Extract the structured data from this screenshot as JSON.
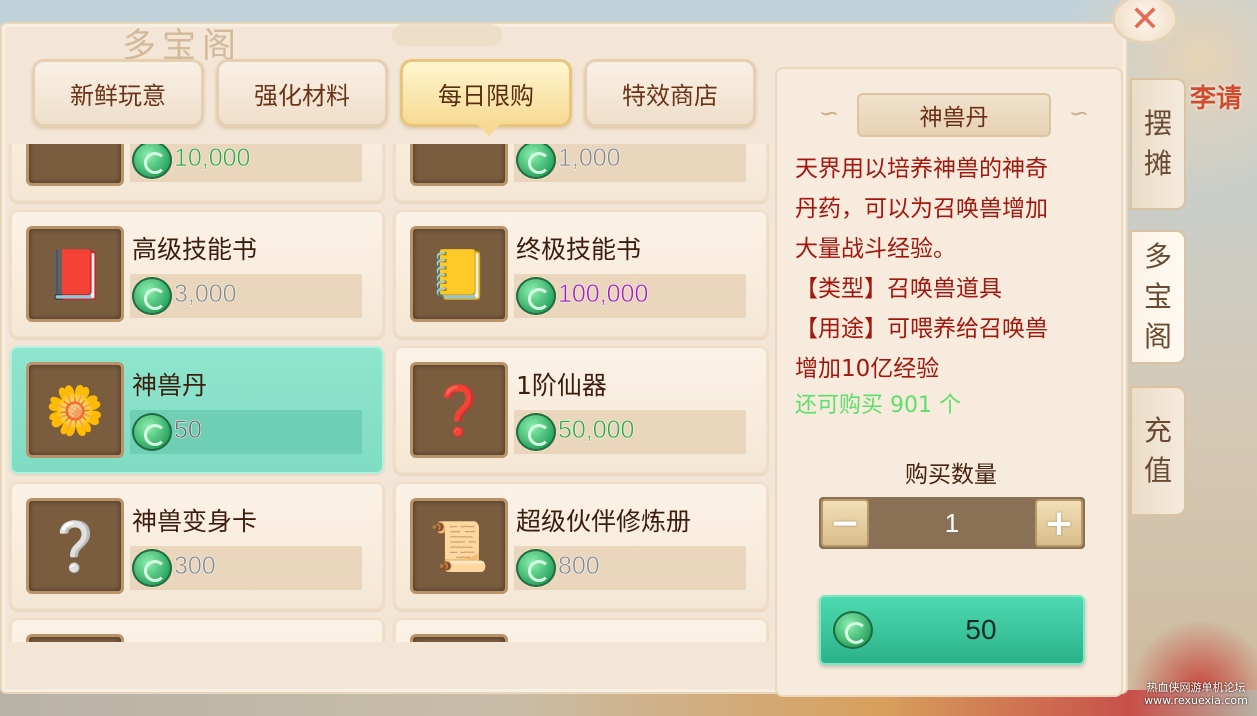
{
  "panel": {
    "title": "多宝阁"
  },
  "tabs": [
    {
      "label": "新鲜玩意"
    },
    {
      "label": "强化材料"
    },
    {
      "label": "每日限购",
      "active": true
    },
    {
      "label": "特效商店"
    }
  ],
  "items": [
    {
      "name": "",
      "price": "10,000",
      "price_color": "#34a845",
      "icon": "treasure-chest-icon",
      "glyph": ""
    },
    {
      "name": "",
      "price": "1,000",
      "price_color": "#8a8a8a",
      "icon": "blue-book-icon",
      "glyph": ""
    },
    {
      "name": "高级技能书",
      "price": "3,000",
      "price_color": "#8a8a8a",
      "icon": "red-skill-book-icon",
      "glyph": "📕"
    },
    {
      "name": "终极技能书",
      "price": "100,000",
      "price_color": "#a622b5",
      "icon": "gold-skill-book-icon",
      "glyph": "📒"
    },
    {
      "name": "神兽丹",
      "price": "50",
      "price_color": "#6b6b6b",
      "icon": "divine-pill-icon",
      "glyph": "🌼",
      "selected": true
    },
    {
      "name": "1阶仙器",
      "price": "50,000",
      "price_color": "#34a845",
      "icon": "mystery-artifact-icon",
      "glyph": "❓"
    },
    {
      "name": "神兽变身卡",
      "price": "300",
      "price_color": "#8a8a8a",
      "icon": "transform-card-icon",
      "glyph": "❔"
    },
    {
      "name": "超级伙伴修炼册",
      "price": "800",
      "price_color": "#8a8a8a",
      "icon": "training-manual-icon",
      "glyph": "📜"
    },
    {
      "name": "",
      "price": "",
      "price_color": "#8a8a8a",
      "icon": "item-icon",
      "glyph": ""
    },
    {
      "name": "",
      "price": "",
      "price_color": "#8a8a8a",
      "icon": "item-icon",
      "glyph": ""
    }
  ],
  "detail": {
    "title": "神兽丹",
    "desc_lines": [
      "天界用以培养神兽的神奇",
      "丹药，可以为召唤兽增加",
      "大量战斗经验。",
      "【类型】召唤兽道具",
      "【用途】可喂养给召唤兽",
      "增加10亿经验"
    ],
    "remaining": "还可购买 901 个",
    "qty_label": "购买数量",
    "qty_minus": "−",
    "qty_plus": "+",
    "qty_value": "1",
    "buy_price": "50"
  },
  "side_tabs": [
    {
      "chars": [
        "摆",
        "摊"
      ]
    },
    {
      "chars": [
        "多",
        "宝",
        "阁"
      ],
      "active": true
    },
    {
      "chars": [
        "充",
        "值"
      ]
    }
  ],
  "close_label": "✕",
  "topright": "李请",
  "watermark": [
    "热血侠网游单机论坛",
    "www.rexuexia.com"
  ]
}
